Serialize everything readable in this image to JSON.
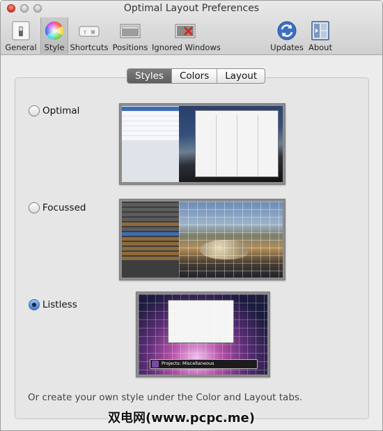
{
  "window": {
    "title": "Optimal Layout Preferences"
  },
  "toolbar": {
    "items": [
      {
        "label": "General",
        "icon": "switch-icon"
      },
      {
        "label": "Style",
        "icon": "color-wheel-icon",
        "selected": true
      },
      {
        "label": "Shortcuts",
        "icon": "keyboard-shortcut-icon"
      },
      {
        "label": "Positions",
        "icon": "window-position-icon"
      },
      {
        "label": "Ignored Windows",
        "icon": "ignored-window-icon"
      },
      {
        "label": "Updates",
        "icon": "updates-sync-icon"
      },
      {
        "label": "About",
        "icon": "about-icon"
      }
    ]
  },
  "tabs": [
    {
      "label": "Styles",
      "active": true
    },
    {
      "label": "Colors",
      "active": false
    },
    {
      "label": "Layout",
      "active": false
    }
  ],
  "styles": [
    {
      "label": "Optimal",
      "checked": false
    },
    {
      "label": "Focussed",
      "checked": false
    },
    {
      "label": "Listless",
      "checked": true
    }
  ],
  "listless_preview": {
    "caption": "Projects: Miscellaneous"
  },
  "footer": {
    "text": "Or create your own style under the Color and Layout tabs."
  },
  "watermark": {
    "text": "双电网(www.pcpc.me)"
  },
  "colors": {
    "accent": "#3c6db4",
    "close": "#d6321f",
    "selected_tab": "#6a6a6a"
  }
}
